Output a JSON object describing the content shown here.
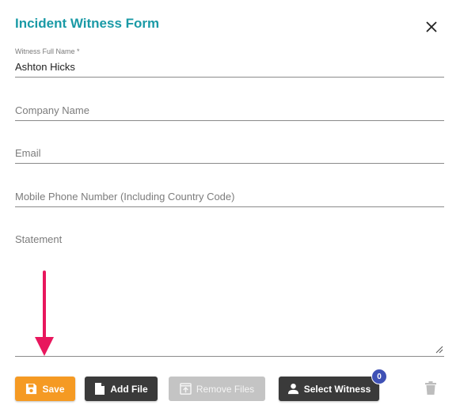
{
  "dialog": {
    "title": "Incident Witness Form"
  },
  "fields": {
    "witness_name": {
      "label": "Witness Full Name *",
      "value": "Ashton Hicks"
    },
    "company": {
      "placeholder": "Company Name"
    },
    "email": {
      "placeholder": "Email"
    },
    "mobile": {
      "placeholder": "Mobile Phone Number (Including Country Code)"
    },
    "statement": {
      "placeholder": "Statement"
    }
  },
  "actions": {
    "save_label": "Save",
    "add_file_label": "Add File",
    "remove_files_label": "Remove Files",
    "select_witness_label": "Select Witness",
    "witness_count": "0"
  },
  "colors": {
    "title": "#1a9aa6",
    "save": "#f59a23",
    "dark_button": "#3a3a3a",
    "disabled_button": "#c4c4c4",
    "badge": "#3f51b5",
    "annotation_arrow": "#e8175d"
  },
  "icons": {
    "close": "close-icon",
    "save": "floppy-disk-icon",
    "add_file": "file-icon",
    "remove_files": "upload-box-icon",
    "select_witness": "person-icon",
    "delete": "trash-icon",
    "annotation": "arrow-down-icon"
  }
}
